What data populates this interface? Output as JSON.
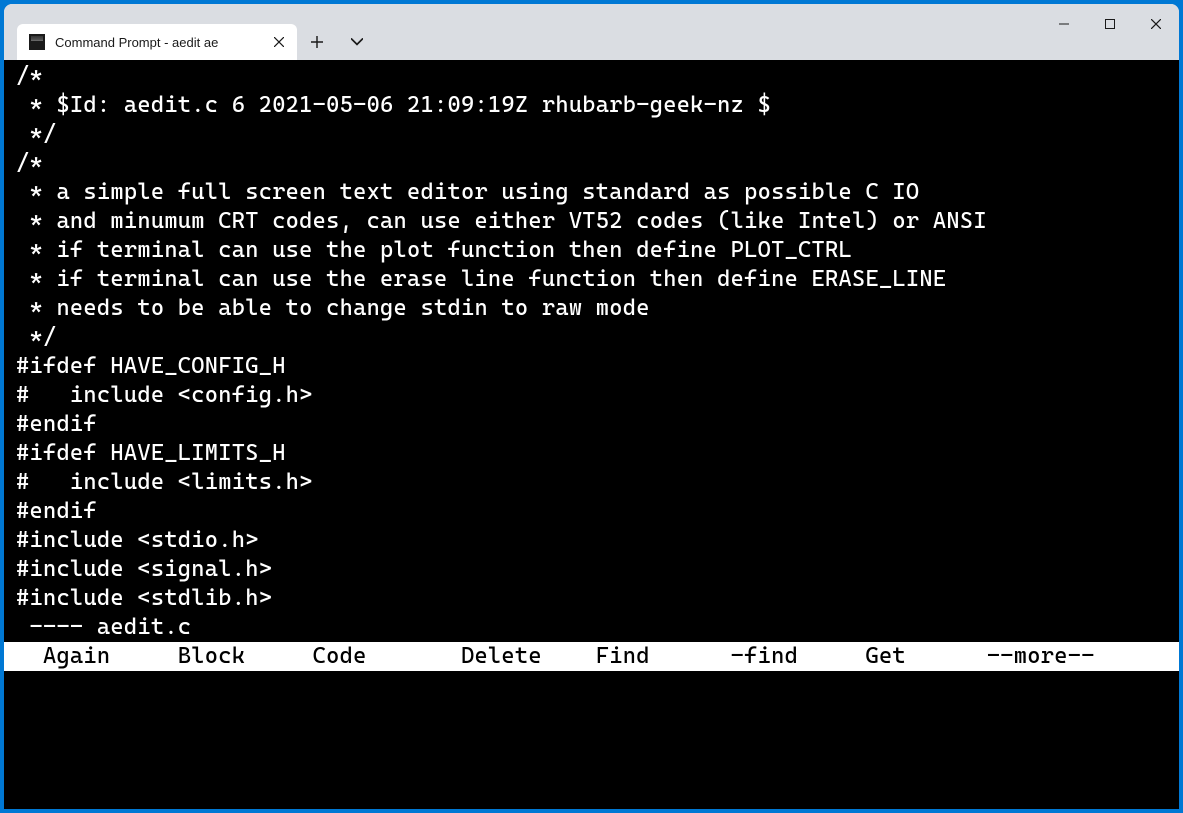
{
  "window": {
    "tab_title": "Command Prompt - aedit  ae"
  },
  "code_lines": [
    "/*",
    " * $Id: aedit.c 6 2021-05-06 21:09:19Z rhubarb-geek-nz $",
    " */",
    "",
    "/*",
    " * a simple full screen text editor using standard as possible C IO",
    " * and minumum CRT codes, can use either VT52 codes (like Intel) or ANSI",
    " * if terminal can use the plot function then define PLOT_CTRL",
    " * if terminal can use the erase line function then define ERASE_LINE",
    " * needs to be able to change stdin to raw mode",
    " */",
    "",
    "#ifdef HAVE_CONFIG_H",
    "#   include <config.h>",
    "#endif",
    "",
    "#ifdef HAVE_LIMITS_H",
    "#   include <limits.h>",
    "#endif",
    "",
    "#include <stdio.h>",
    "#include <signal.h>",
    "#include <stdlib.h>"
  ],
  "status_line": " ---- aedit.c",
  "menu": {
    "items": [
      "Again",
      "Block",
      "Code",
      "Delete",
      "Find",
      "-find",
      "Get",
      "--more--"
    ]
  }
}
